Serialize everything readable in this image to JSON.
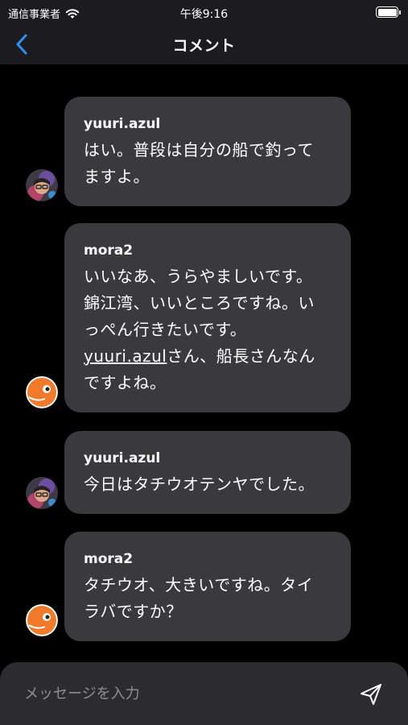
{
  "status_bar": {
    "carrier": "通信事業者",
    "time": "午後9:16"
  },
  "nav": {
    "title": "コメント",
    "back_icon": "chevron-left-icon",
    "accent_color": "#2f8ff5"
  },
  "comments": [
    {
      "author": "yuuri.azul",
      "avatar": "photo-avatar",
      "lines": [
        "はい。普段は自分の船で釣って",
        "ますよ。"
      ]
    },
    {
      "author": "mora2",
      "avatar": "orange-fish-avatar",
      "lines": [
        "いいなあ、うらやましいです。",
        "錦江湾、いいところですね。い",
        "っぺん行きたいです。"
      ],
      "mention": "yuuri.azul",
      "mention_rest": "さん、船長さんなん",
      "last_line": "ですよね。"
    },
    {
      "author": "yuuri.azul",
      "avatar": "photo-avatar",
      "lines": [
        "今日はタチウオテンヤでした。"
      ]
    },
    {
      "author": "mora2",
      "avatar": "orange-fish-avatar",
      "lines": [
        "タチウオ、大きいですね。タイ",
        "ラバですか？"
      ]
    }
  ],
  "input": {
    "placeholder": "メッセージを入力",
    "value": ""
  },
  "send_icon": "send-paper-plane-icon"
}
